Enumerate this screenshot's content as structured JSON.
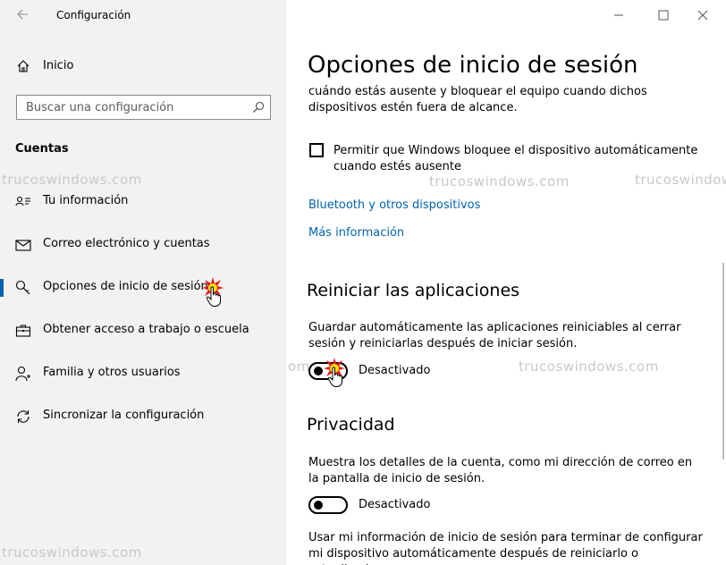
{
  "window": {
    "title": "Configuración"
  },
  "sidebar": {
    "home_label": "Inicio",
    "search_placeholder": "Buscar una configuración",
    "section_title": "Cuentas",
    "items": [
      {
        "label": "Tu información",
        "icon": "person-card-icon"
      },
      {
        "label": "Correo electrónico y cuentas",
        "icon": "mail-icon"
      },
      {
        "label": "Opciones de inicio de sesión",
        "icon": "key-icon",
        "active": true
      },
      {
        "label": "Obtener acceso a trabajo o escuela",
        "icon": "briefcase-icon"
      },
      {
        "label": "Familia y otros usuarios",
        "icon": "people-icon"
      },
      {
        "label": "Sincronizar la configuración",
        "icon": "sync-icon"
      }
    ]
  },
  "main": {
    "title": "Opciones de inicio de sesión",
    "dynamic_lock_text": "cuándo estás ausente y bloquear el equipo cuando dichos dispositivos estén fuera de alcance.",
    "checkbox_label": "Permitir que Windows bloquee el dispositivo automáticamente cuando estés ausente",
    "link_bluetooth": "Bluetooth y otros dispositivos",
    "link_more_info": "Más información",
    "restart_apps": {
      "heading": "Reiniciar las aplicaciones",
      "description": "Guardar automáticamente las aplicaciones reiniciables al cerrar sesión y reiniciarlas después de iniciar sesión.",
      "toggle_state": "Desactivado"
    },
    "privacy": {
      "heading": "Privacidad",
      "description": "Muestra los detalles de la cuenta, como mi dirección de correo en la pantalla de inicio de sesión.",
      "toggle_state": "Desactivado",
      "description2": "Usar mi información de inicio de sesión para terminar de configurar mi dispositivo automáticamente después de reiniciarlo o actualizarlo."
    }
  },
  "watermark": "trucoswindows.com",
  "colors": {
    "accent": "#0063b1",
    "sidebar_bg": "#f2f2f2"
  }
}
